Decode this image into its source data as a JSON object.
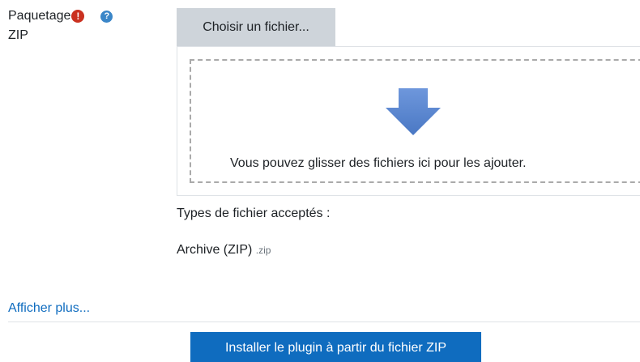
{
  "field": {
    "label_line1": "Paquetage",
    "label_line2": "ZIP",
    "required_icon": "exclamation-circle-icon",
    "help_icon": "question-circle-icon"
  },
  "filepicker": {
    "choose_label": "Choisir un fichier...",
    "drop_text": "Vous pouvez glisser des fichiers ici pour les ajouter.",
    "arrow_icon": "download-arrow-icon",
    "arrow_color": "#5b87d0"
  },
  "accepted": {
    "title": "Types de fichier acceptés :",
    "type_name": "Archive (ZIP)",
    "type_ext": ".zip"
  },
  "show_more": "Afficher plus...",
  "submit_label": "Installer le plugin à partir du fichier ZIP",
  "colors": {
    "primary": "#0f6cbf",
    "required": "#ca3120",
    "help": "#3a86c8",
    "choose_bg": "#ced4da"
  }
}
